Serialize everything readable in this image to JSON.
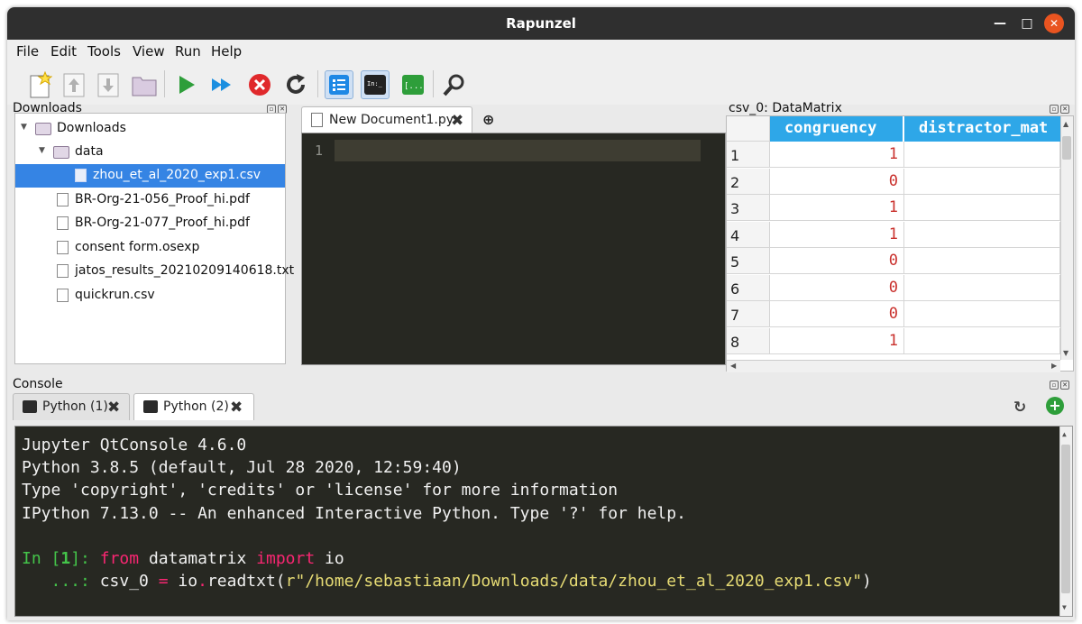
{
  "window": {
    "title": "Rapunzel"
  },
  "menu": [
    "File",
    "Edit",
    "Tools",
    "View",
    "Run",
    "Help"
  ],
  "toolbar": {
    "icons": [
      "new-file-icon",
      "move-up-icon",
      "move-down-icon",
      "open-folder-icon",
      "run-icon",
      "run-fast-icon",
      "stop-icon",
      "restart-icon",
      "outline-icon",
      "terminal-icon",
      "json-brackets-icon",
      "search-icon"
    ],
    "terminal_glyph": "In:_",
    "brackets_glyph": "[...]"
  },
  "downloads": {
    "title": "Downloads",
    "items": [
      {
        "label": "Downloads",
        "type": "folder",
        "level": 0,
        "expanded": true
      },
      {
        "label": "data",
        "type": "folder",
        "level": 1,
        "expanded": true
      },
      {
        "label": "zhou_et_al_2020_exp1.csv",
        "type": "file",
        "level": 2,
        "selected": true
      },
      {
        "label": "BR-Org-21-056_Proof_hi.pdf",
        "type": "file",
        "level": 1
      },
      {
        "label": "BR-Org-21-077_Proof_hi.pdf",
        "type": "file",
        "level": 1
      },
      {
        "label": "consent form.osexp",
        "type": "file",
        "level": 1
      },
      {
        "label": "jatos_results_20210209140618.txt",
        "type": "file",
        "level": 1
      },
      {
        "label": "quickrun.csv",
        "type": "file",
        "level": 1
      }
    ]
  },
  "editor": {
    "tab_label": "New Document1.py",
    "add_tab_glyph": "⊕",
    "line_numbers": [
      "1"
    ]
  },
  "datamatrix": {
    "title": "csv_0: DataMatrix",
    "columns": [
      "congruency",
      "distractor_mat"
    ],
    "row_labels": [
      "1",
      "2",
      "3",
      "4",
      "5",
      "6",
      "7",
      "8"
    ],
    "congruency": [
      "1",
      "0",
      "1",
      "1",
      "0",
      "0",
      "0",
      "1"
    ]
  },
  "console": {
    "title": "Console",
    "tabs": [
      "Python (1)",
      "Python (2)"
    ],
    "active_tab": 1,
    "banner": [
      "Jupyter QtConsole 4.6.0",
      "Python 3.8.5 (default, Jul 28 2020, 12:59:40)",
      "Type 'copyright', 'credits' or 'license' for more information",
      "IPython 7.13.0 -- An enhanced Interactive Python. Type '?' for help."
    ],
    "prompt_in": "In [",
    "prompt_num": "1",
    "prompt_close": "]:",
    "kw_from": "from",
    "module": "datamatrix",
    "kw_import": "import",
    "name_io": "io",
    "cont_prompt": "   ...:",
    "assign_lhs": "csv_0",
    "assign_op": "=",
    "call_obj": "io",
    "call_dot": ".",
    "call_fn": "readtxt(",
    "str_prefix": "r",
    "str_value": "\"/home/sebastiaan/Downloads/data/zhou_et_al_2020_exp1.csv\"",
    "call_close": ")"
  },
  "colors": {
    "accent": "#3584e4",
    "header": "#2ea7e8",
    "editor_bg": "#272822",
    "close": "#e95420"
  }
}
